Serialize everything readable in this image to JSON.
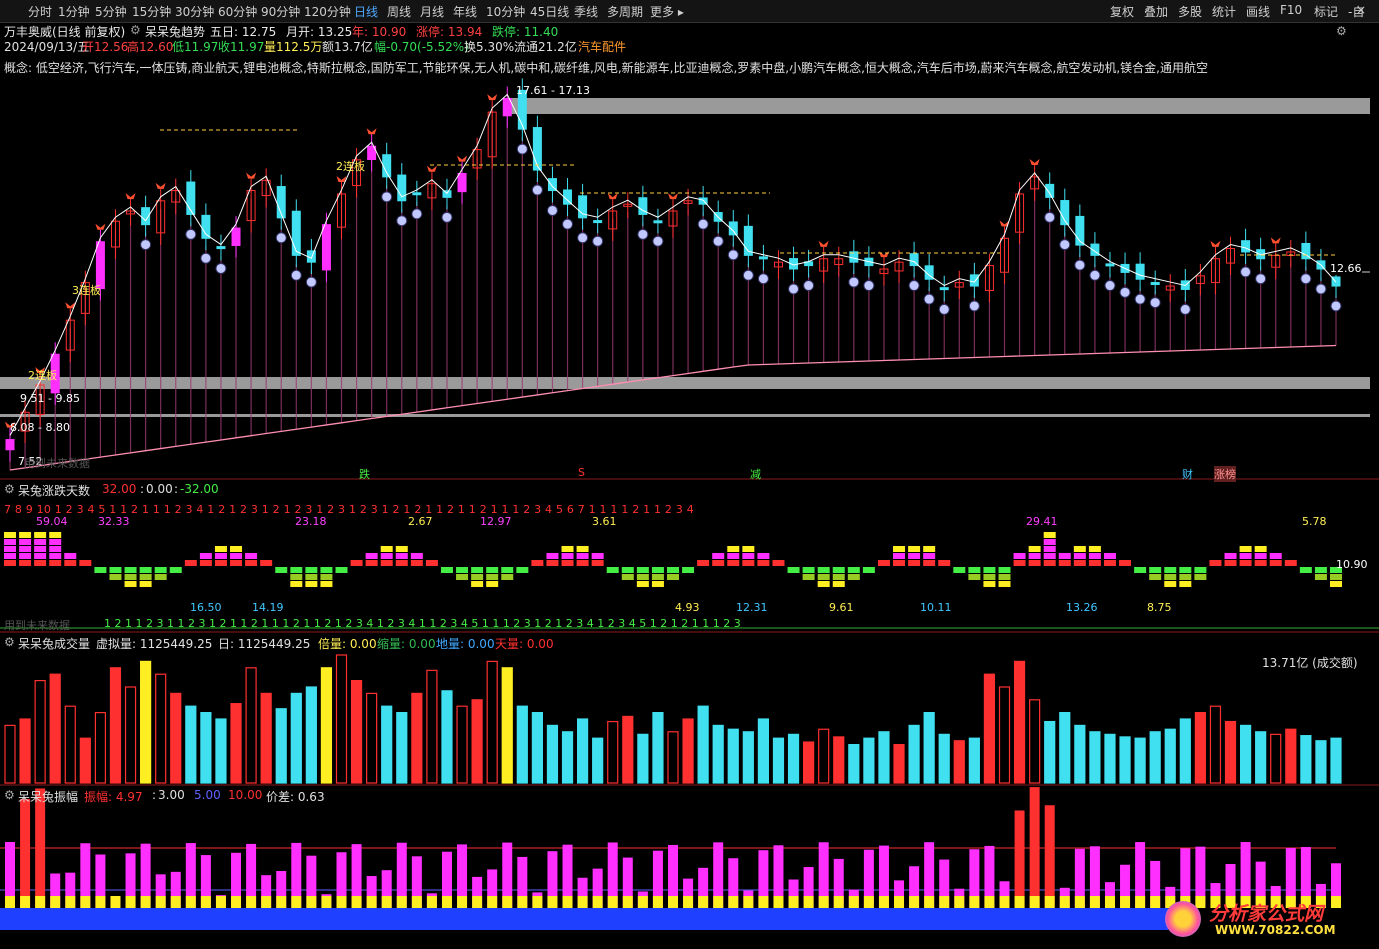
{
  "toolbar": {
    "periods": [
      "分时",
      "1分钟",
      "5分钟",
      "15分钟",
      "30分钟",
      "60分钟",
      "90分钟",
      "120分钟",
      "日线",
      "周线",
      "月线",
      "年线",
      "10分钟",
      "45日线",
      "季线",
      "多周期",
      "更多"
    ],
    "active_period": "日线",
    "right_tools": [
      "复权",
      "叠加",
      "多股",
      "统计",
      "画线",
      "F10",
      "标记",
      "-自"
    ]
  },
  "stock": {
    "name": "万丰奥威(日线 前复权)",
    "indicator": "呆呆兔趋势",
    "five_day": "五日: 12.75",
    "month_open": "月开: 13.25",
    "year": "年: 10.90",
    "limit_up": "涨停: 13.94",
    "limit_down": "跌停: 11.40",
    "date": "2024/09/13/五",
    "open": "开12.56",
    "high": "高12.60",
    "low": "低11.97",
    "close": "收11.97",
    "volume": "量112.5万",
    "amount": "额13.7亿",
    "change": "幅-0.70(-5.52%)",
    "turnover": "换5.30%",
    "float_cap": "流通21.2亿",
    "sector": "汽车配件"
  },
  "concepts": "概念: 低空经济,飞行汽车,一体压铸,商业航天,锂电池概念,特斯拉概念,国防军工,节能环保,无人机,碳中和,碳纤维,风电,新能源车,比亚迪概念,罗素中盘,小鹏汽车概念,恒大概念,汽车后市场,蔚来汽车概念,航空发动机,镁合金,通用航空",
  "price_labels": {
    "range1": "17.61 - 17.13",
    "range2": "9.51 - 9.85",
    "range3": "8.08 - 8.80",
    "low_mark": "7.52",
    "last_price": "12.66",
    "board2": "2连板",
    "board2b": "2连板",
    "board3": "3连板",
    "sig_fall": "跌",
    "sig_s": "S",
    "sig_reduce": "减",
    "sig_cai": "财",
    "sig_zhangbang": "涨榜",
    "watermark_text": "用到未来数据"
  },
  "panel2": {
    "title": "呆兔涨跌天数",
    "v1": "32.00",
    "v2": "0.00",
    "v3": "-32.00",
    "top_values": [
      "59.04",
      "32.33",
      "23.18",
      "2.67",
      "12.97",
      "3.61",
      "29.41",
      "5.78"
    ],
    "bottom_values": [
      "16.50",
      "14.19",
      "4.93",
      "12.31",
      "9.61",
      "10.11",
      "13.26",
      "8.75"
    ],
    "right_value": "10.90",
    "seq_top": "7 8 9 10  1 2 3 4 5     1   1 2      1   1    1 2 3 4    1 2    1 2 3   1 2    1 2 3    1 2 3   1 2 3    1 2         1 2         1    1 2        1   1 2   1    1     1 2 3 4 5 6 7       1   1         1    1 2    1   1 2 3 4",
    "seq_bottom": "1 2    1      1 2 3   1       1 2 3         1 2    1    1 2        1      1    1 2    1      1 2    1 2 3 4   1 2 3 4   1    1 2 3 4 5   1    1   1 2 3   1 2     1 2 3 4   1 2 3 4 5   1 2   1 2    1    1    1 2 3",
    "future_note": "用到未来数据"
  },
  "panel3": {
    "title": "呆呆兔成交量",
    "virtual": "虚拟量: 1125449.25",
    "day": "日: 1125449.25",
    "ratio": "倍量: 0.00",
    "shrink": "缩量: 0.00",
    "ground": "地量: 0.00",
    "sky": "天量: 0.00",
    "amount_label": "13.71亿 (成交额)"
  },
  "panel4": {
    "title": "呆呆兔振幅",
    "amp": "振幅: 4.97",
    "a": "3.00",
    "b": "5.00",
    "c": "10.00",
    "diff": "价差: 0.63"
  },
  "watermark": "分析家公式网www.70822.com",
  "logo": {
    "line1": "分析家公式网",
    "line2": "WWW.70822.COM"
  },
  "colors": {
    "up": "#ff3030",
    "down": "#40e0f0",
    "magenta": "#ff30ff",
    "yellow": "#ffee22",
    "green": "#44ee44",
    "blue": "#2040ff"
  },
  "chart_data": {
    "type": "bar",
    "title": "万丰奥威(日线 前复权)",
    "candles_close_approx": [
      7.6,
      8.4,
      9.2,
      10.1,
      11.1,
      12.2,
      13.4,
      14.0,
      14.3,
      13.9,
      14.6,
      14.9,
      14.2,
      13.5,
      13.2,
      13.8,
      14.9,
      15.2,
      14.1,
      13.0,
      12.8,
      13.9,
      14.8,
      15.8,
      16.2,
      15.3,
      14.6,
      14.8,
      15.1,
      14.7,
      15.4,
      16.1,
      17.2,
      17.6,
      16.7,
      15.5,
      14.9,
      14.5,
      14.1,
      14.0,
      14.3,
      14.5,
      14.2,
      14.0,
      14.3,
      14.6,
      14.5,
      14.0,
      13.6,
      13.0,
      12.9,
      12.8,
      12.6,
      12.7,
      12.9,
      12.9,
      12.8,
      12.7,
      12.6,
      12.8,
      12.7,
      12.3,
      12.0,
      12.2,
      12.1,
      12.7,
      13.5,
      14.8,
      15.3,
      14.7,
      13.9,
      13.3,
      13.0,
      12.7,
      12.5,
      12.3,
      12.2,
      12.1,
      12.0,
      12.4,
      12.9,
      13.2,
      13.1,
      12.9,
      13.0,
      13.1,
      12.9,
      12.6,
      12.1
    ],
    "volume_relative": [
      0.45,
      0.5,
      0.8,
      0.85,
      0.6,
      0.35,
      0.55,
      0.9,
      0.75,
      0.95,
      0.85,
      0.7,
      0.6,
      0.55,
      0.5,
      0.62,
      0.9,
      0.7,
      0.58,
      0.7,
      0.75,
      0.9,
      1.0,
      0.8,
      0.7,
      0.6,
      0.55,
      0.7,
      0.88,
      0.72,
      0.6,
      0.65,
      0.95,
      0.9,
      0.6,
      0.55,
      0.45,
      0.4,
      0.5,
      0.35,
      0.48,
      0.52,
      0.38,
      0.55,
      0.4,
      0.5,
      0.6,
      0.45,
      0.42,
      0.4,
      0.5,
      0.35,
      0.38,
      0.32,
      0.42,
      0.36,
      0.3,
      0.35,
      0.4,
      0.3,
      0.45,
      0.55,
      0.38,
      0.33,
      0.35,
      0.85,
      0.75,
      0.95,
      0.65,
      0.48,
      0.55,
      0.45,
      0.4,
      0.38,
      0.36,
      0.35,
      0.4,
      0.42,
      0.5,
      0.55,
      0.6,
      0.48,
      0.45,
      0.4,
      0.38,
      0.42,
      0.37,
      0.33,
      0.35
    ]
  }
}
